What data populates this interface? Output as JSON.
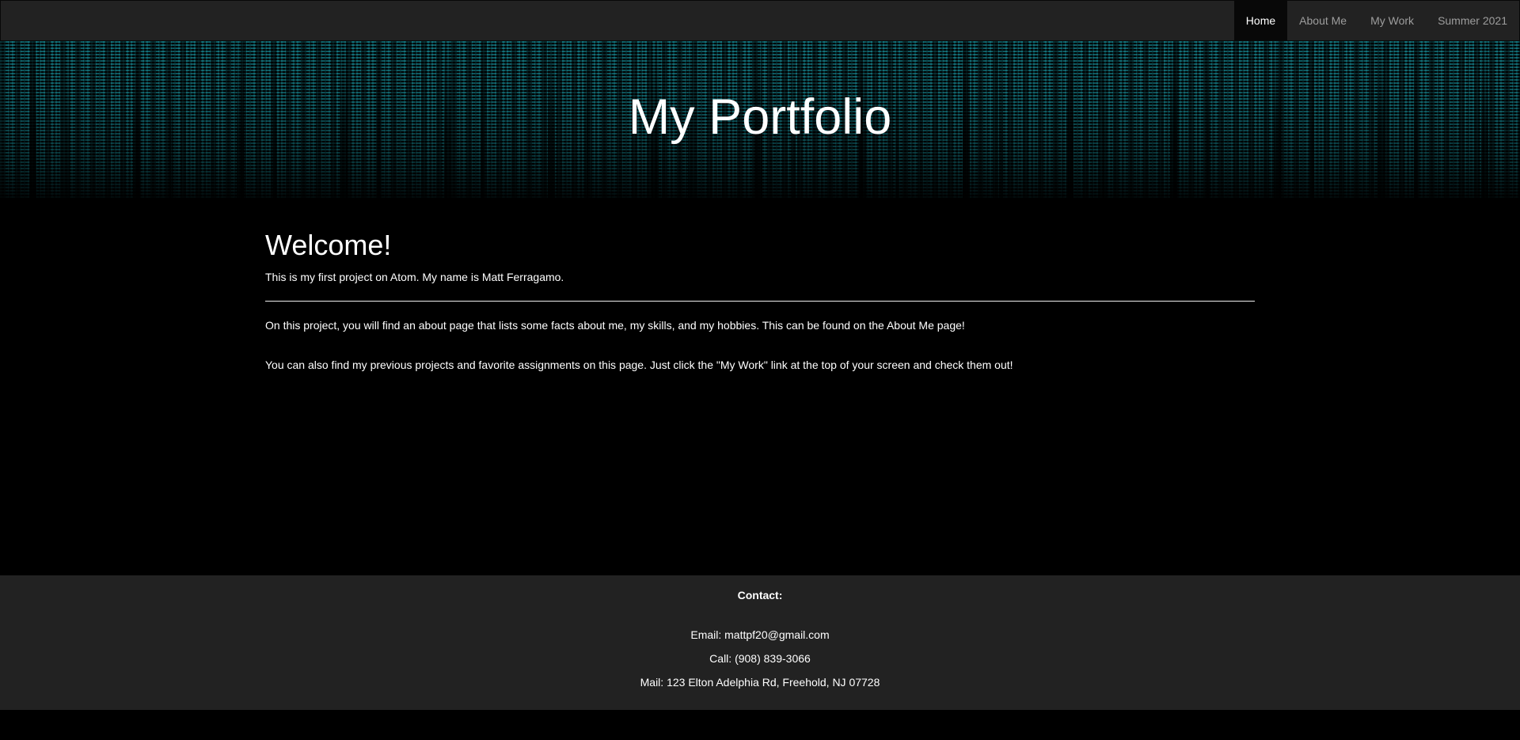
{
  "nav": {
    "items": [
      {
        "label": "Home",
        "active": true
      },
      {
        "label": "About Me",
        "active": false
      },
      {
        "label": "My Work",
        "active": false
      },
      {
        "label": "Summer 2021",
        "active": false
      }
    ]
  },
  "hero": {
    "title": "My Portfolio"
  },
  "main": {
    "heading": "Welcome!",
    "intro": "This is my first project on Atom. My name is Matt Ferragamo.",
    "paragraphs": [
      "On this project, you will find an about page that lists some facts about me, my skills, and my hobbies. This can be found on the About Me page!",
      "You can also find my previous projects and favorite assignments on this page. Just click the \"My Work\" link at the top of your screen and check them out!"
    ]
  },
  "footer": {
    "heading": "Contact:",
    "email": "Email: mattpf20@gmail.com",
    "phone": "Call: (908) 839-3066",
    "mail": "Mail: 123 Elton Adelphia Rd, Freehold, NJ 07728"
  },
  "colors": {
    "navbar_bg": "#222222",
    "nav_active_bg": "#080808",
    "nav_text": "#9d9d9d",
    "page_bg": "#000000",
    "footer_bg": "#222222",
    "hero_tint": "#147882"
  }
}
